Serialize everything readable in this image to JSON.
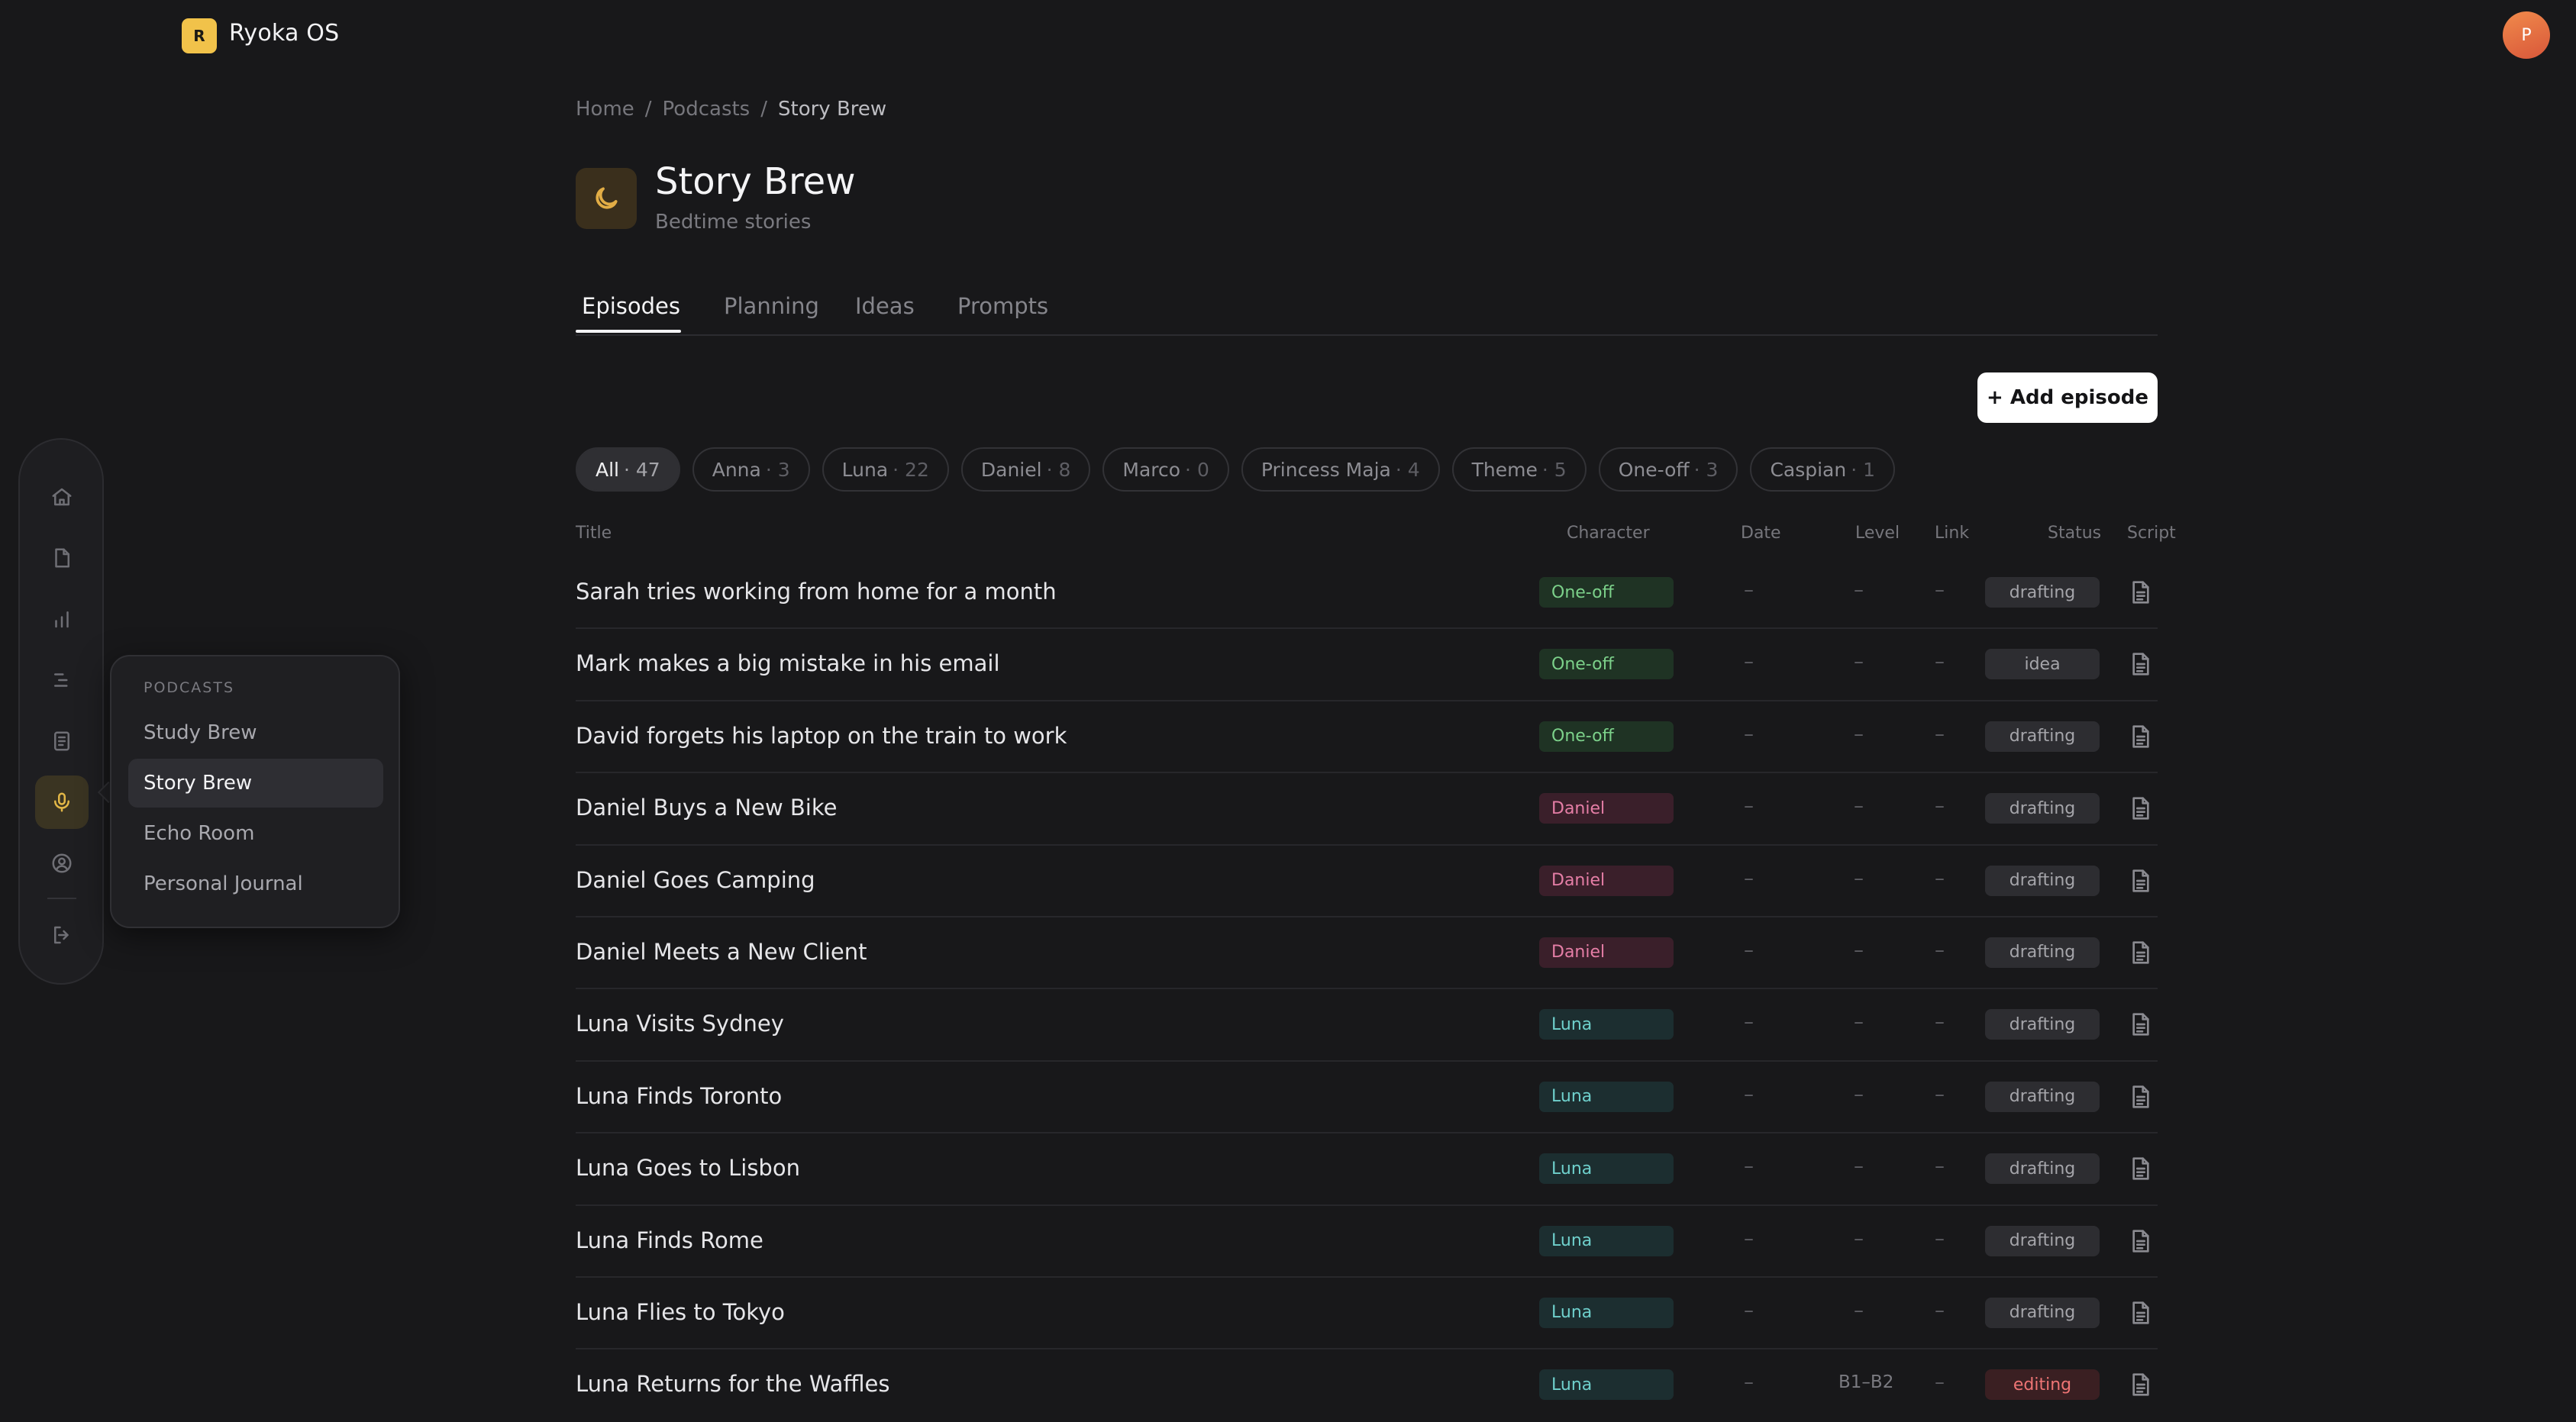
{
  "app": {
    "logo_letter": "R",
    "title": "Ryoka OS",
    "avatar_initial": "P"
  },
  "rail": {
    "items": [
      {
        "icon": "home-icon"
      },
      {
        "icon": "document-icon"
      },
      {
        "icon": "chart-icon"
      },
      {
        "icon": "timeline-icon"
      },
      {
        "icon": "notes-icon"
      },
      {
        "icon": "microphone-icon",
        "active": true
      },
      {
        "icon": "user-circle-icon"
      },
      {
        "icon": "logout-icon"
      }
    ]
  },
  "flyout": {
    "heading": "PODCASTS",
    "items": [
      {
        "label": "Study Brew"
      },
      {
        "label": "Story Brew",
        "active": true
      },
      {
        "label": "Echo Room"
      },
      {
        "label": "Personal Journal"
      }
    ]
  },
  "breadcrumb": {
    "items": [
      "Home",
      "Podcasts",
      "Story Brew"
    ],
    "separator": "/"
  },
  "podcast": {
    "title": "Story Brew",
    "subtitle": "Bedtime stories",
    "icon": "moon-icon"
  },
  "tabs": [
    {
      "label": "Episodes",
      "active": true
    },
    {
      "label": "Planning"
    },
    {
      "label": "Ideas"
    },
    {
      "label": "Prompts"
    }
  ],
  "add_button": "+ Add episode",
  "filters": [
    {
      "label": "All",
      "count": "· 47",
      "active": true
    },
    {
      "label": "Anna",
      "count": "· 3"
    },
    {
      "label": "Luna",
      "count": "· 22"
    },
    {
      "label": "Daniel",
      "count": "· 8"
    },
    {
      "label": "Marco",
      "count": "· 0"
    },
    {
      "label": "Princess Maja",
      "count": "· 4"
    },
    {
      "label": "Theme",
      "count": "· 5"
    },
    {
      "label": "One-off",
      "count": "· 3"
    },
    {
      "label": "Caspian",
      "count": "· 1"
    }
  ],
  "table": {
    "columns": {
      "title": "Title",
      "character": "Character",
      "date": "Date",
      "level": "Level",
      "link": "Link",
      "status": "Status",
      "script": "Script"
    },
    "rows": [
      {
        "title": "Sarah tries working from home for a month",
        "character": "One-off",
        "char_class": "oneoff",
        "date": "–",
        "level": "–",
        "link": "–",
        "status": "drafting"
      },
      {
        "title": "Mark makes a big mistake in his email",
        "character": "One-off",
        "char_class": "oneoff",
        "date": "–",
        "level": "–",
        "link": "–",
        "status": "idea"
      },
      {
        "title": "David forgets his laptop on the train to work",
        "character": "One-off",
        "char_class": "oneoff",
        "date": "–",
        "level": "–",
        "link": "–",
        "status": "drafting"
      },
      {
        "title": "Daniel Buys a New Bike",
        "character": "Daniel",
        "char_class": "daniel",
        "date": "–",
        "level": "–",
        "link": "–",
        "status": "drafting"
      },
      {
        "title": "Daniel Goes Camping",
        "character": "Daniel",
        "char_class": "daniel",
        "date": "–",
        "level": "–",
        "link": "–",
        "status": "drafting"
      },
      {
        "title": "Daniel Meets a New Client",
        "character": "Daniel",
        "char_class": "daniel",
        "date": "–",
        "level": "–",
        "link": "–",
        "status": "drafting"
      },
      {
        "title": "Luna Visits Sydney",
        "character": "Luna",
        "char_class": "luna",
        "date": "–",
        "level": "–",
        "link": "–",
        "status": "drafting"
      },
      {
        "title": "Luna Finds Toronto",
        "character": "Luna",
        "char_class": "luna",
        "date": "–",
        "level": "–",
        "link": "–",
        "status": "drafting"
      },
      {
        "title": "Luna Goes to Lisbon",
        "character": "Luna",
        "char_class": "luna",
        "date": "–",
        "level": "–",
        "link": "–",
        "status": "drafting"
      },
      {
        "title": "Luna Finds Rome",
        "character": "Luna",
        "char_class": "luna",
        "date": "–",
        "level": "–",
        "link": "–",
        "status": "drafting"
      },
      {
        "title": "Luna Flies to Tokyo",
        "character": "Luna",
        "char_class": "luna",
        "date": "–",
        "level": "–",
        "link": "–",
        "status": "drafting"
      },
      {
        "title": "Luna Returns for the Waffles",
        "character": "Luna",
        "char_class": "luna",
        "date": "–",
        "level": "B1–B2",
        "link": "–",
        "status": "editing"
      }
    ]
  },
  "colors": {
    "background": "#18181a",
    "accent": "#f1c24a",
    "oneoff": "#7cd18a",
    "daniel": "#e57ea6",
    "luna": "#6fd0cc",
    "editing": "#ee7474"
  }
}
